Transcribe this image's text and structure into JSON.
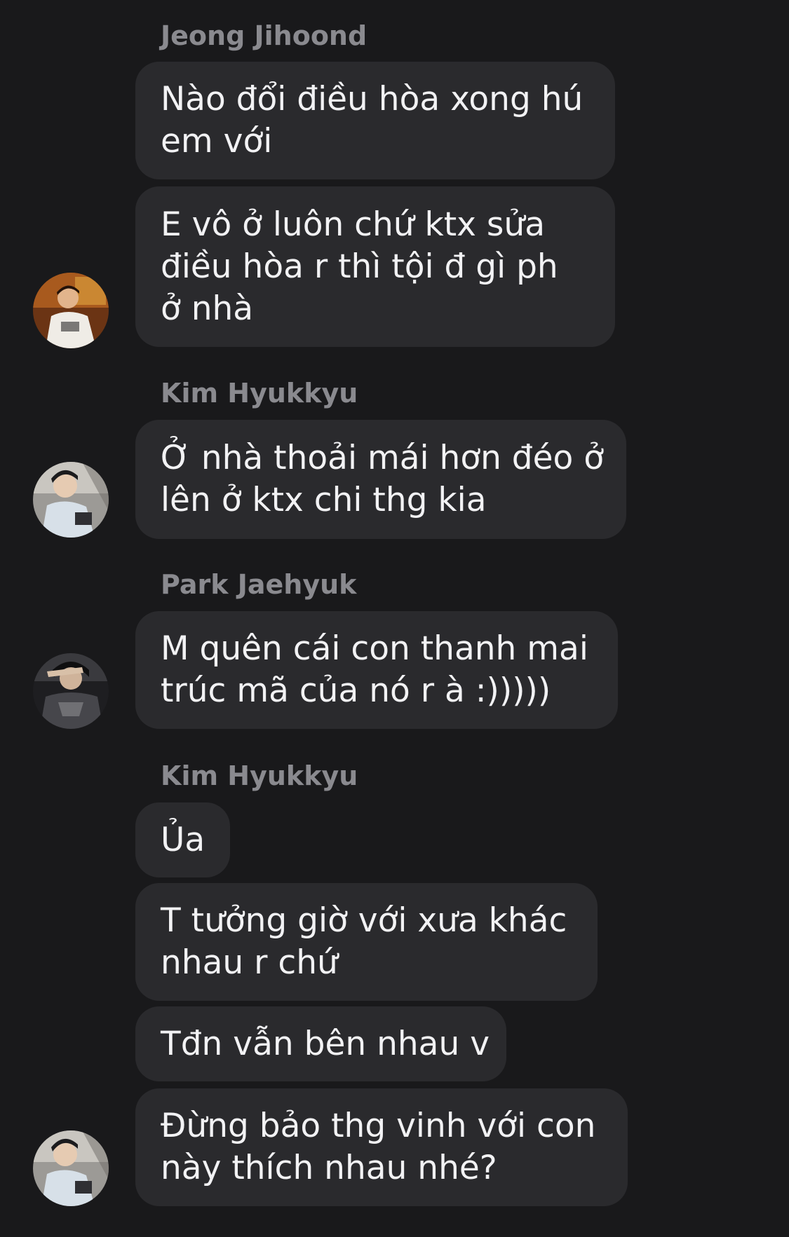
{
  "messages": [
    {
      "sender": "Jeong Jihoond",
      "texts": [
        "Nào đổi điều hòa xong hú em với",
        "E vô ở luôn chứ ktx sửa điều hòa r thì tội đ gì ph ở nhà"
      ],
      "avatar": "profile-photo-icon"
    },
    {
      "sender": "Kim Hyukkyu",
      "texts": [
        "Ở nhà thoải mái hơn đéo ở lên ở ktx chi thg kia"
      ],
      "avatar": "profile-photo-icon"
    },
    {
      "sender": "Park Jaehyuk",
      "texts": [
        "M quên cái con thanh mai trúc mã của nó r à :)))))"
      ],
      "avatar": "profile-photo-icon"
    },
    {
      "sender": "Kim Hyukkyu",
      "texts": [
        "Ủa",
        "T tưởng giờ với xưa khác nhau r chứ",
        "Tđn vẫn bên nhau v",
        "Đừng bảo thg vinh với con này thích nhau nhé?"
      ],
      "avatar": "profile-photo-icon"
    }
  ],
  "colors": {
    "background": "#19191b",
    "bubble": "#2a2a2d",
    "text": "#f2f2f4",
    "sender_name": "#8a8a8f"
  }
}
